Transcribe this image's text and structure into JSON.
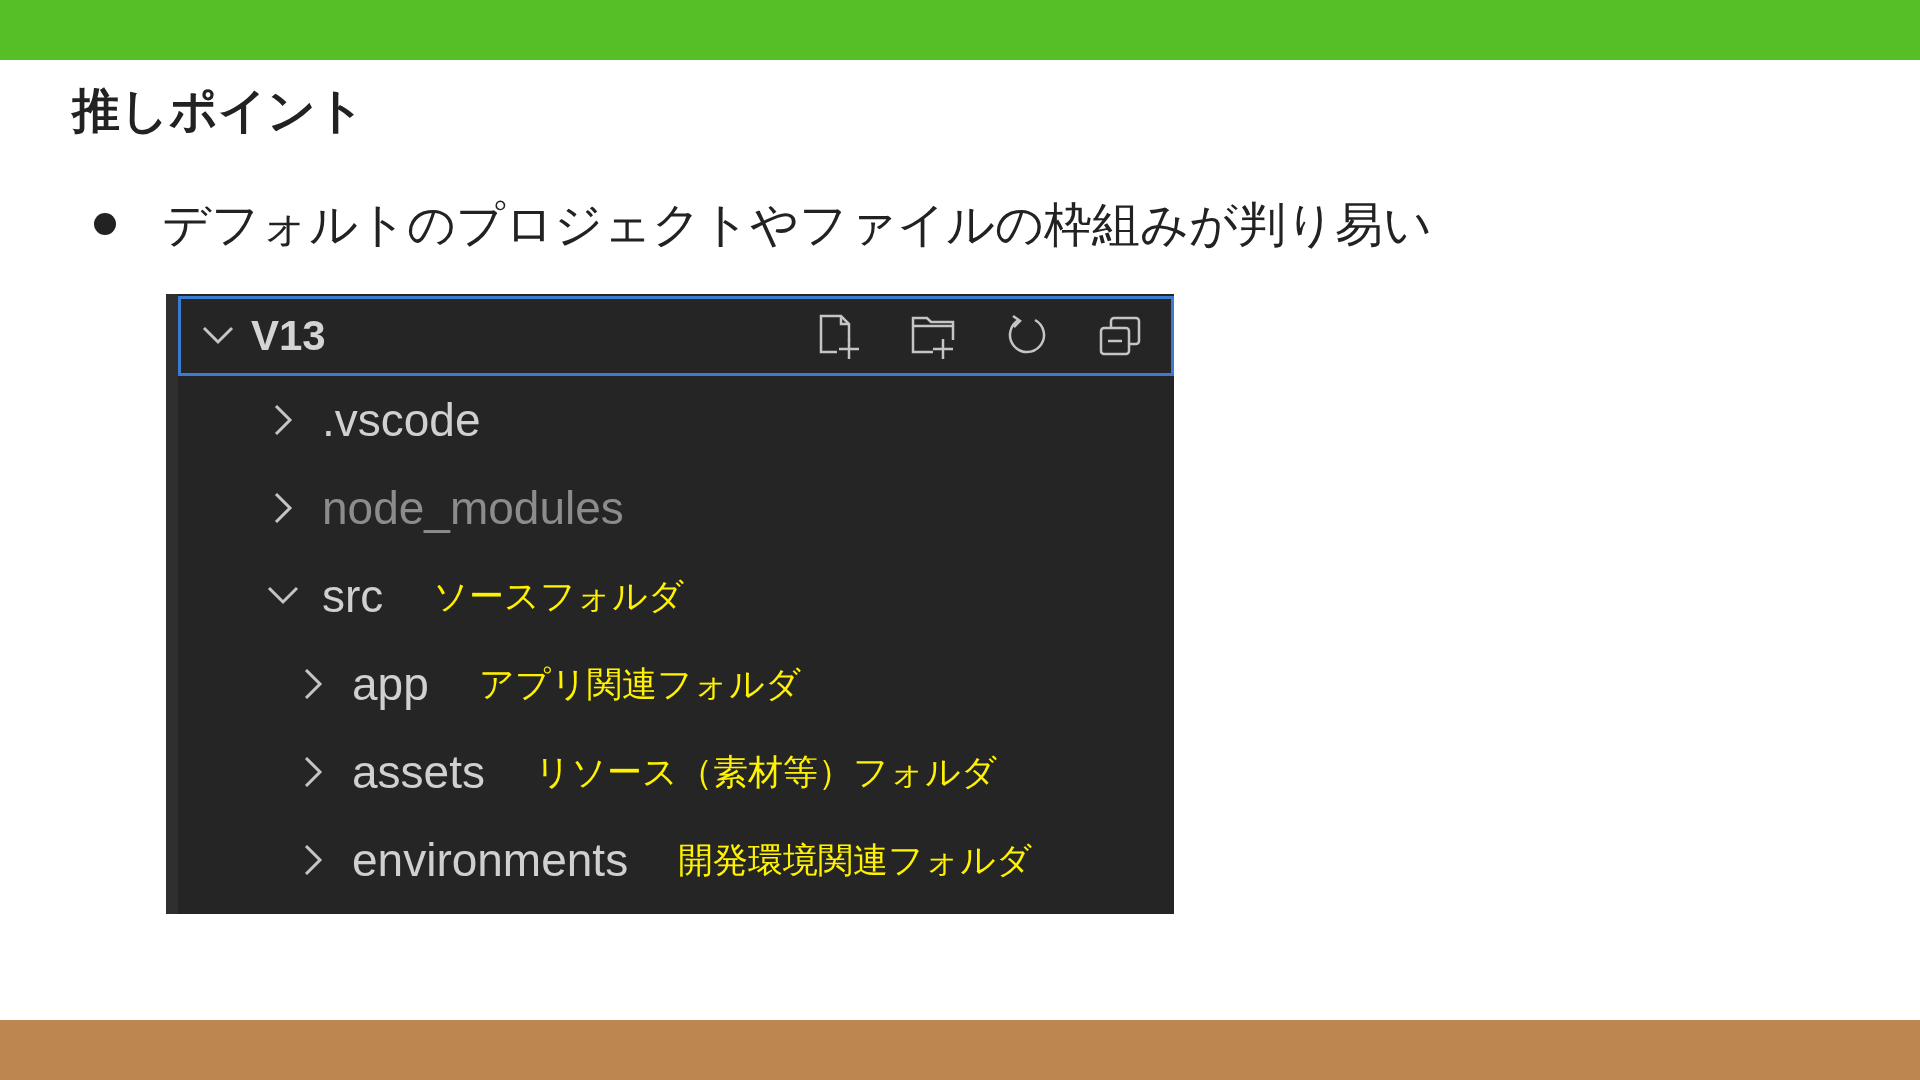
{
  "title": "推しポイント",
  "bullets": [
    "デフォルトのプロジェクトやファイルの枠組みが判り易い"
  ],
  "explorer": {
    "root": {
      "name": "V13",
      "expanded": true,
      "focused": true
    },
    "actions": [
      {
        "kind": "new-file"
      },
      {
        "kind": "new-folder"
      },
      {
        "kind": "refresh"
      },
      {
        "kind": "collapse"
      }
    ],
    "children": [
      {
        "name": ".vscode",
        "expanded": false,
        "dimmed": false
      },
      {
        "name": "node_modules",
        "expanded": false,
        "dimmed": true
      },
      {
        "name": "src",
        "expanded": true,
        "dimmed": false,
        "note": "ソースフォルダ",
        "children": [
          {
            "name": "app",
            "expanded": false,
            "dimmed": false,
            "note": "アプリ関連フォルダ"
          },
          {
            "name": "assets",
            "expanded": false,
            "dimmed": false,
            "note": "リソース（素材等）フォルダ"
          },
          {
            "name": "environments",
            "expanded": false,
            "dimmed": false,
            "note": "開発環境関連フォルダ"
          }
        ]
      }
    ]
  }
}
